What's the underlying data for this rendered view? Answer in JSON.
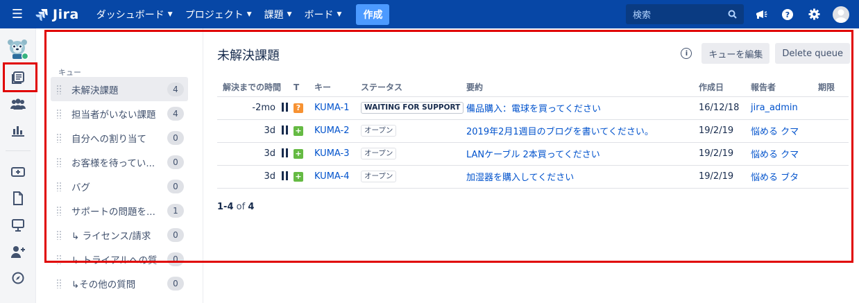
{
  "topbar": {
    "app_name": "Jira",
    "nav": [
      {
        "label": "ダッシュボード"
      },
      {
        "label": "プロジェクト"
      },
      {
        "label": "課題"
      },
      {
        "label": "ボード"
      }
    ],
    "create_label": "作成",
    "search_placeholder": "検索",
    "icons": [
      "notifications-megaphone-icon",
      "help-icon",
      "settings-gear-icon",
      "user-avatar"
    ]
  },
  "left_nav": {
    "icons": [
      "project-avatar",
      "queues-icon",
      "customers-icon",
      "reports-icon",
      "add-item-icon",
      "knowledge-base-icon",
      "channels-icon",
      "invite-team-icon",
      "compass-icon"
    ],
    "selected": "queues-icon"
  },
  "sidebar": {
    "heading": "キュー",
    "queues": [
      {
        "label": "未解決課題",
        "count": "4",
        "selected": true
      },
      {
        "label": "担当者がいない課題",
        "count": "4"
      },
      {
        "label": "自分への割り当て",
        "count": "0"
      },
      {
        "label": "お客様を待ってい...",
        "count": "0"
      },
      {
        "label": "バグ",
        "count": "0"
      },
      {
        "label": "サポートの問題を...",
        "count": "1"
      },
      {
        "label": "↳ ライセンス/請求",
        "count": "0"
      },
      {
        "label": "↳ トライアルへの質",
        "count": "0"
      },
      {
        "label": "↳その他の質問",
        "count": "0"
      }
    ]
  },
  "main": {
    "title": "未解決課題",
    "edit_queue_label": "キューを編集",
    "delete_queue_label": "Delete queue",
    "columns": {
      "time": "解決までの時間",
      "type": "T",
      "key": "キー",
      "status": "ステータス",
      "summary": "要約",
      "created": "作成日",
      "reporter": "報告者",
      "due": "期限"
    },
    "rows": [
      {
        "time": "-2mo",
        "type": "question",
        "type_icon": "?",
        "type_color": "#f79232",
        "key": "KUMA-1",
        "status": "WAITING FOR SUPPORT",
        "summary": "備品購入：電球を買ってください",
        "created": "16/12/18",
        "reporter": "jira_admin"
      },
      {
        "time": "3d",
        "type": "new-feature",
        "type_icon": "+",
        "type_color": "#65ba43",
        "key": "KUMA-2",
        "status": "オープン",
        "summary": "2019年2月1週目のブログを書いてください。",
        "created": "19/2/19",
        "reporter": "悩める クマ"
      },
      {
        "time": "3d",
        "type": "new-feature",
        "type_icon": "+",
        "type_color": "#65ba43",
        "key": "KUMA-3",
        "status": "オープン",
        "summary": "LANケーブル 2本買ってください",
        "created": "19/2/19",
        "reporter": "悩める クマ"
      },
      {
        "time": "3d",
        "type": "new-feature",
        "type_icon": "+",
        "type_color": "#65ba43",
        "key": "KUMA-4",
        "status": "オープン",
        "summary": "加湿器を購入してください",
        "created": "19/2/19",
        "reporter": "悩める ブタ"
      }
    ],
    "pager": {
      "range": "1-4",
      "of": "of",
      "total": "4"
    }
  },
  "colors": {
    "topbar": "#0747a6",
    "link": "#0052cc",
    "annotation": "#e00000"
  }
}
